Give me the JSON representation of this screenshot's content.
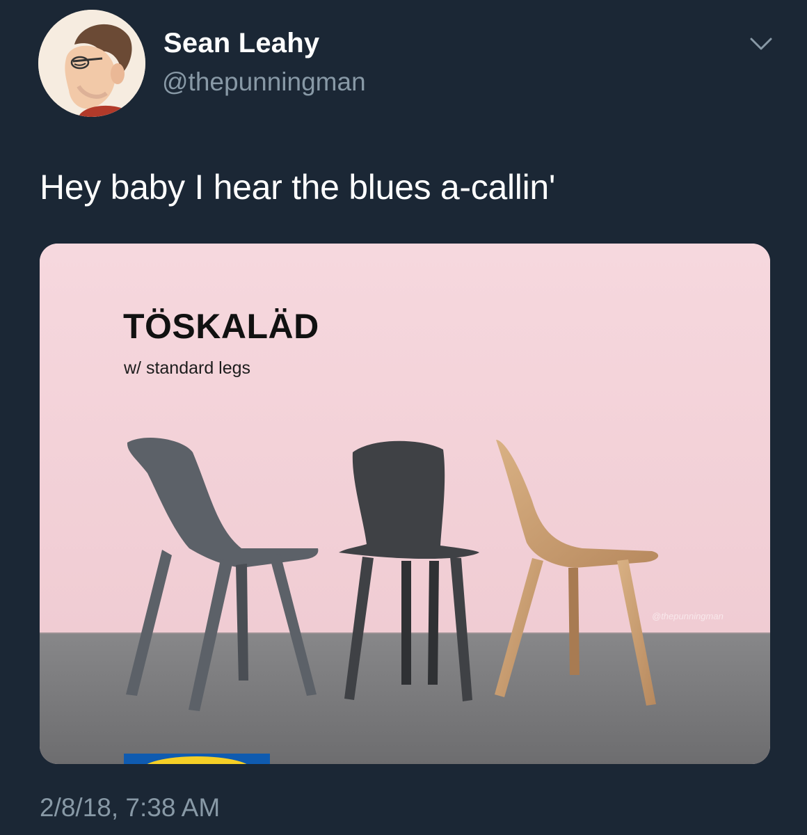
{
  "author": {
    "display_name": "Sean Leahy",
    "handle": "@thepunningman",
    "avatar_icon": "cartoon-portrait-avatar"
  },
  "menu_icon": "chevron-down-icon",
  "tweet": {
    "text": "Hey baby I hear the blues a-callin'",
    "timestamp": "2/8/18, 7:38 AM"
  },
  "media": {
    "product_name": "TÖSKALÄD",
    "product_subtitle": "w/ standard legs",
    "watermark": "@thepunningman",
    "colors": {
      "wall": "#f4d3da",
      "floor": "#7b7b7d",
      "chair_left": "#5c6168",
      "chair_middle": "#3f4145",
      "chair_right": "#c49a70",
      "logo_blue": "#0f5bb0",
      "logo_yellow": "#f5cf26"
    }
  }
}
